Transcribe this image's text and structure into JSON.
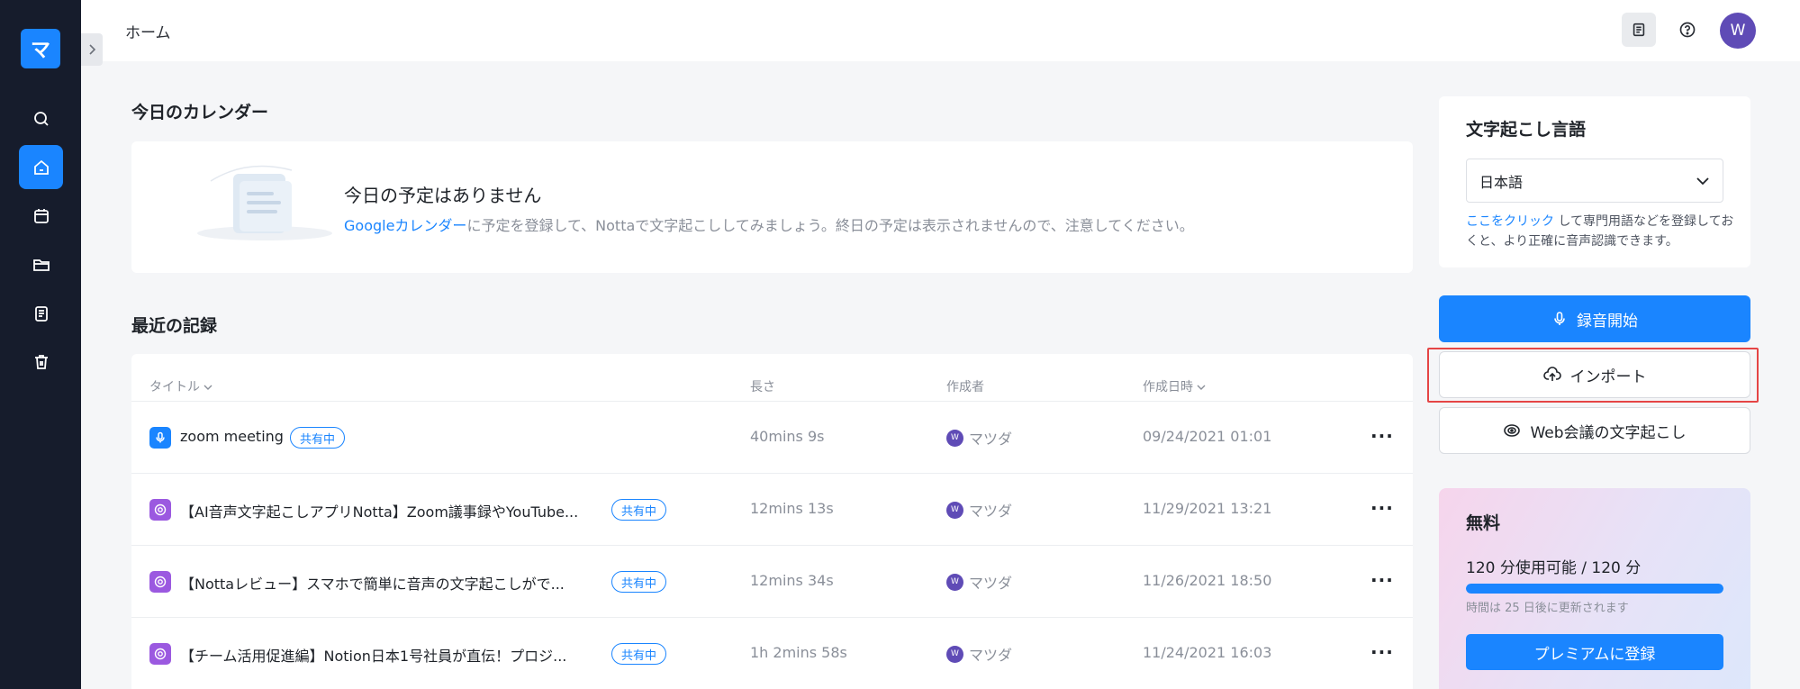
{
  "app": {
    "logo_text": "マ",
    "page_title": "ホーム",
    "avatar_initial": "W"
  },
  "sidebar": {
    "items": [
      {
        "icon": "search-icon"
      },
      {
        "icon": "home-icon",
        "active": true
      },
      {
        "icon": "calendar-icon"
      },
      {
        "icon": "folder-icon"
      },
      {
        "icon": "notes-icon"
      },
      {
        "icon": "trash-icon"
      }
    ]
  },
  "calendar": {
    "section_title": "今日のカレンダー",
    "empty_title": "今日の予定はありません",
    "link_text": "Googleカレンダー",
    "desc_text": "に予定を登録して、Nottaで文字起こししてみましょう。終日の予定は表示されませんので、注意してください。"
  },
  "records": {
    "section_title": "最近の記録",
    "columns": {
      "title": "タイトル",
      "length": "長さ",
      "creator": "作成者",
      "created": "作成日時"
    },
    "rows": [
      {
        "icon": "mic-icon",
        "title": "zoom meeting",
        "badge": "共有中",
        "length": "40mins 9s",
        "creator": "マツダ",
        "creator_initial": "W",
        "date": "09/24/2021 01:01"
      },
      {
        "icon": "chrome-icon",
        "title": "【AI音声文字起こしアプリNotta】Zoom議事録やYouTube...",
        "badge": "共有中",
        "length": "12mins 13s",
        "creator": "マツダ",
        "creator_initial": "W",
        "date": "11/29/2021 13:21"
      },
      {
        "icon": "chrome-icon",
        "title": "【Nottaレビュー】スマホで簡単に音声の文字起こしがで...",
        "badge": "共有中",
        "length": "12mins 34s",
        "creator": "マツダ",
        "creator_initial": "W",
        "date": "11/26/2021 18:50"
      },
      {
        "icon": "chrome-icon",
        "title": "【チーム活用促進編】Notion日本1号社員が直伝！プロジ...",
        "badge": "共有中",
        "length": "1h 2mins 58s",
        "creator": "マツダ",
        "creator_initial": "W",
        "date": "11/24/2021 16:03"
      }
    ],
    "more_label": "···"
  },
  "language": {
    "title": "文字起こし言語",
    "selected": "日本語",
    "link_text": "ここをクリック",
    "note_text": " して専門用語などを登録しておくと、より正確に音声認識できます。"
  },
  "actions": {
    "record_label": "録音開始",
    "import_label": "インポート",
    "web_label": "Web会議の文字起こし"
  },
  "plan": {
    "name": "無料",
    "usage": "120 分使用可能 / 120 分",
    "usage_fraction": 1.0,
    "note": "時間は 25 日後に更新されます",
    "upgrade_label": "プレミアムに登録"
  },
  "colors": {
    "accent": "#1a85ff",
    "sidebar_bg": "#161c2c",
    "highlight": "#e54545"
  }
}
